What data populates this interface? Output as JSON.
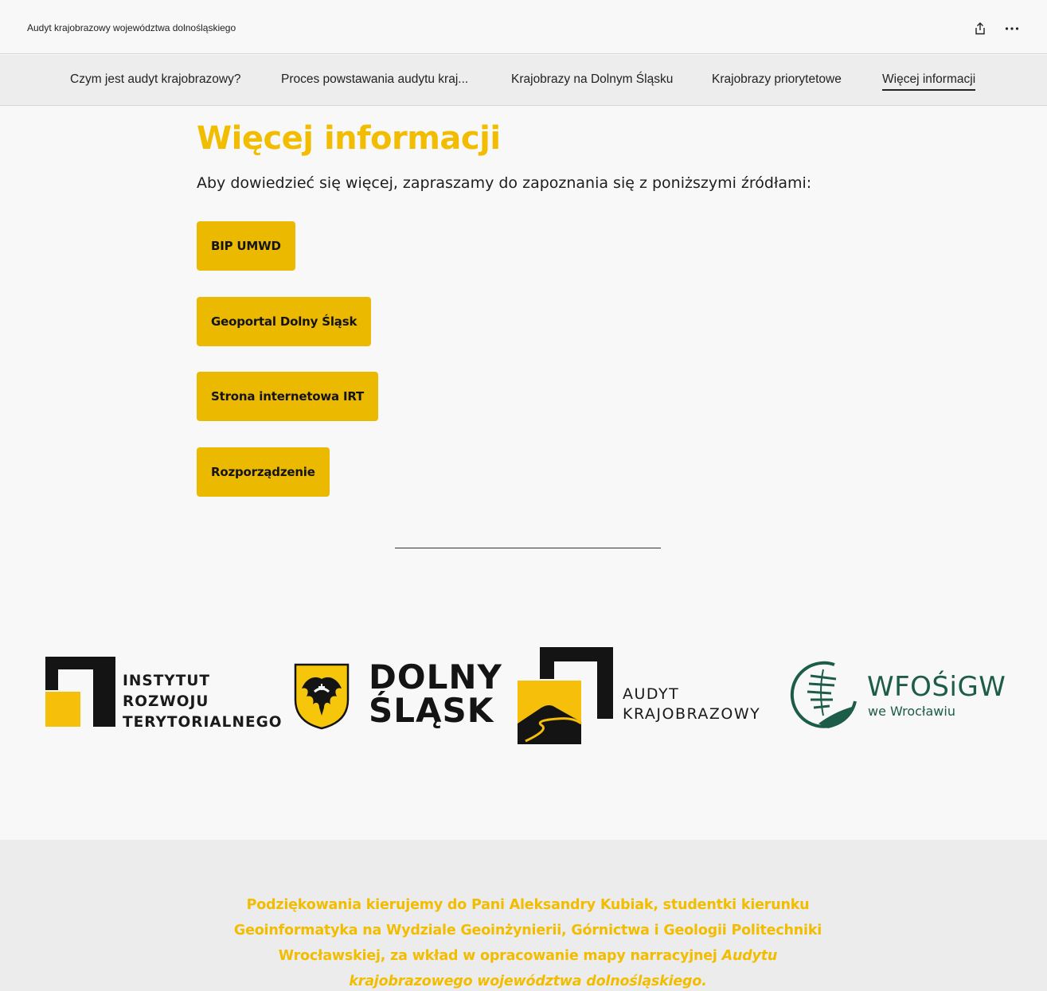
{
  "app": {
    "title": "Audyt krajobrazowy województwa dolnośląskiego",
    "share_icon": "share-icon",
    "more_icon": "more-options-icon"
  },
  "nav": {
    "items": [
      {
        "label": "Czym jest audyt krajobrazowy?"
      },
      {
        "label": "Proces powstawania audytu kraj..."
      },
      {
        "label": "Krajobrazy na Dolnym Śląsku"
      },
      {
        "label": "Krajobrazy priorytetowe"
      },
      {
        "label": "Więcej informacji",
        "active": true
      }
    ]
  },
  "main": {
    "title": "Więcej informacji",
    "intro": "Aby dowiedzieć się więcej, zapraszamy do zapoznania się z poniższymi źródłami:",
    "buttons": [
      {
        "label": "BIP UMWD"
      },
      {
        "label": "Geoportal Dolny Śląsk"
      },
      {
        "label": "Strona internetowa IRT"
      },
      {
        "label": "Rozporządzenie"
      }
    ]
  },
  "logos": {
    "irt": [
      "INSTYTUT",
      "ROZWOJU",
      "TERYTORIALNEGO"
    ],
    "dolny": [
      "DOLNY",
      "ŚLĄSK"
    ],
    "audyt": [
      "AUDYT",
      "KRAJOBRAZOWY"
    ],
    "wfos": {
      "name": "WFOŚiGW",
      "sub": "we Wrocławiu"
    }
  },
  "footer": {
    "thanks": "Podziękowania kierujemy do Pani Aleksandry Kubiak, studentki kierunku Geoinformatyka na Wydziale Geoinżynierii, Górnictwa i Geologii Politechniki Wrocławskiej, za wkład w opracowanie mapy narracyjnej",
    "thanks_italic": "Audytu krajobrazowego województwa dolnośląskiego."
  },
  "colors": {
    "accent": "#f2bd00",
    "button": "#ebb900",
    "wfos_green": "#1c5c48"
  }
}
